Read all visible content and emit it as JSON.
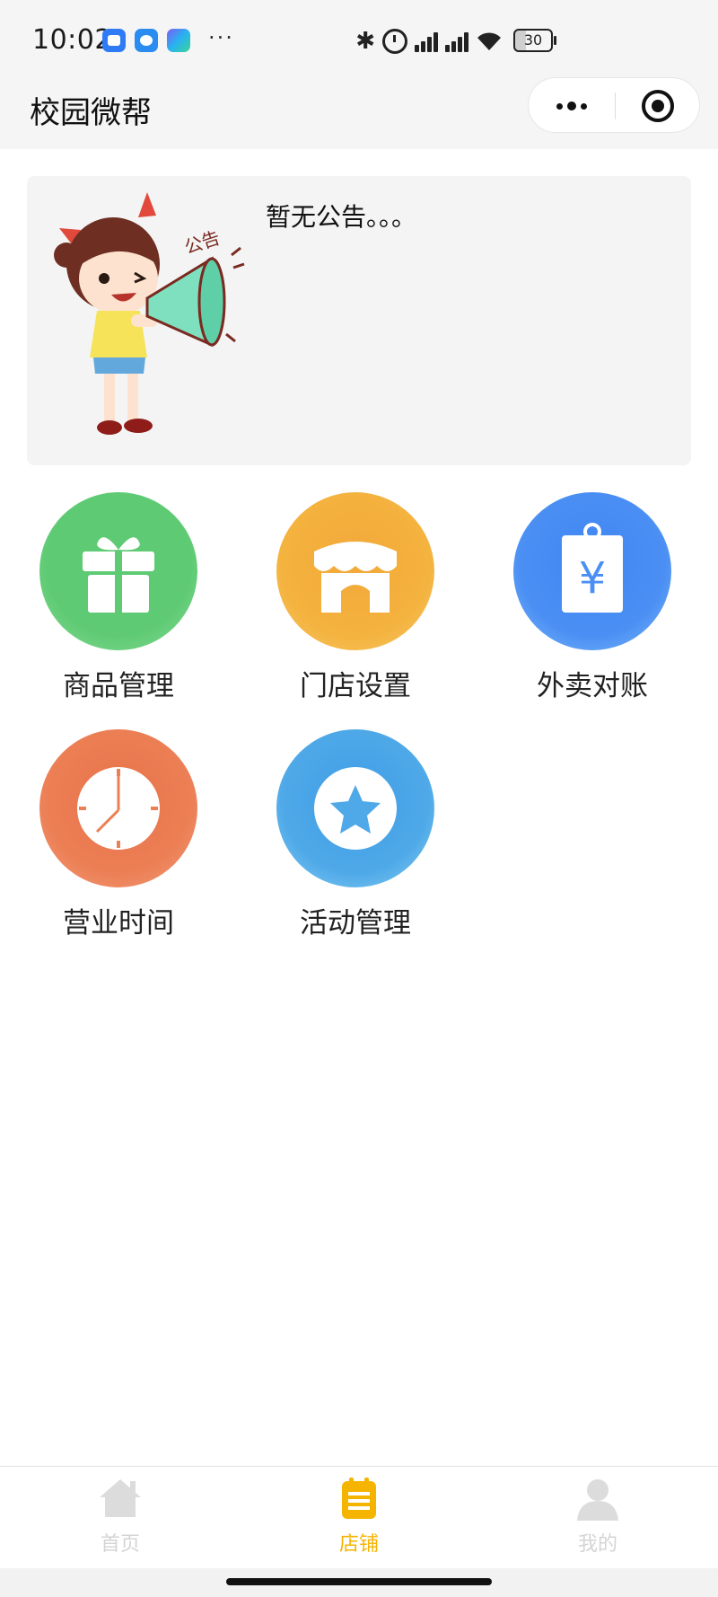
{
  "status_bar": {
    "time": "10:02",
    "more": "···",
    "battery": "30"
  },
  "header": {
    "title": "校园微帮"
  },
  "notice": {
    "text": "暂无公告。。。",
    "illustration_text": "公告"
  },
  "menu": {
    "items": [
      {
        "label": "商品管理",
        "icon": "gift-icon",
        "color": "#5fca74"
      },
      {
        "label": "门店设置",
        "icon": "store-icon",
        "color": "#f4b23e"
      },
      {
        "label": "外卖对账",
        "icon": "price-tag-yen-icon",
        "color": "#4b8ff4"
      },
      {
        "label": "营业时间",
        "icon": "clock-icon",
        "color": "#ec7f55"
      },
      {
        "label": "活动管理",
        "icon": "star-icon",
        "color": "#4fa9e8"
      }
    ]
  },
  "tab_bar": {
    "items": [
      {
        "label": "首页",
        "icon": "home-icon",
        "active": false
      },
      {
        "label": "店铺",
        "icon": "shop-list-icon",
        "active": true
      },
      {
        "label": "我的",
        "icon": "user-icon",
        "active": false
      }
    ],
    "active_color": "#f5b400",
    "inactive_color": "#d4d4d4"
  }
}
